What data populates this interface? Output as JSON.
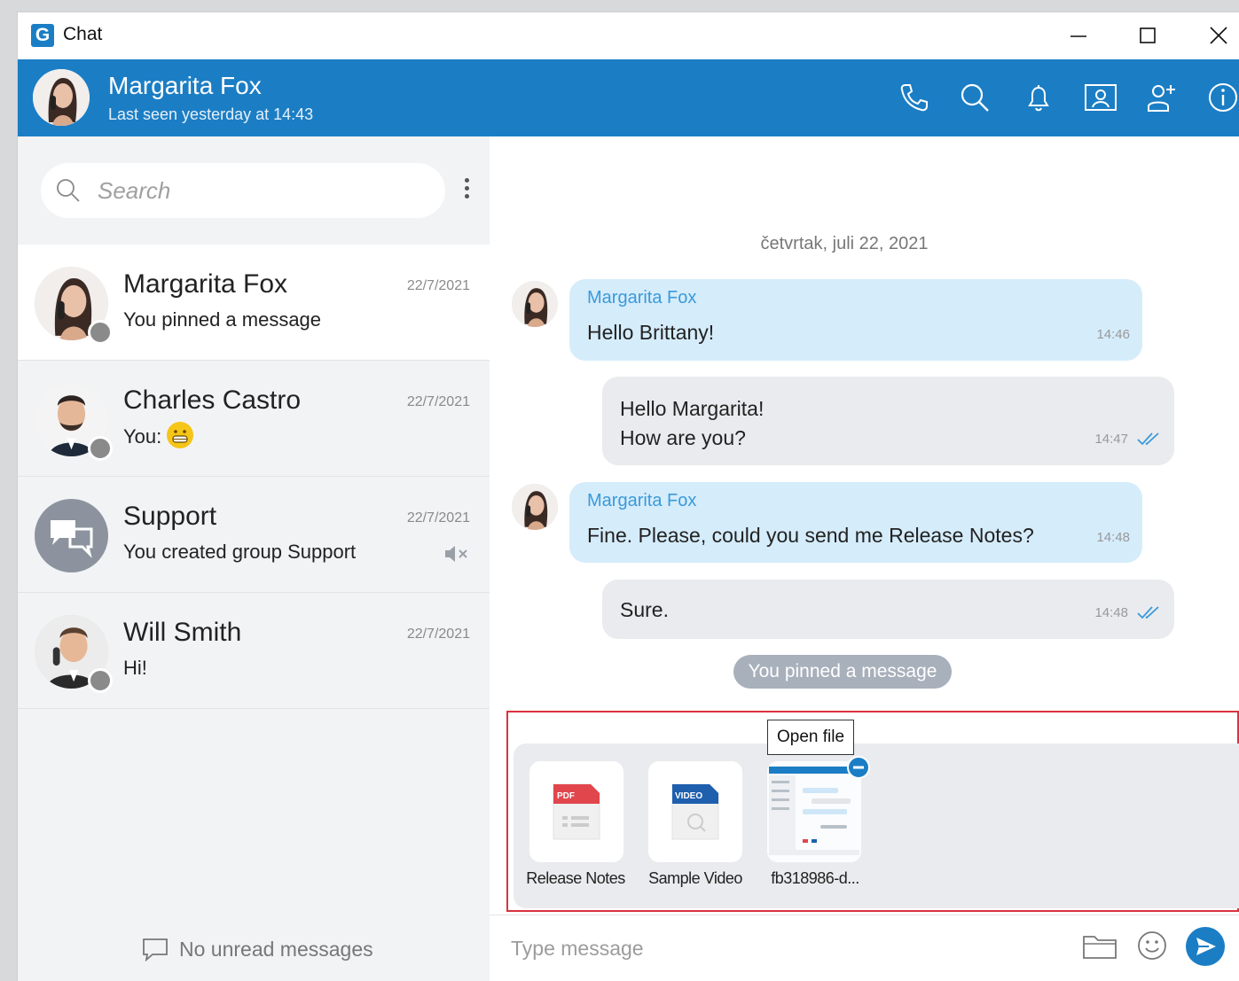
{
  "window": {
    "title": "Chat",
    "logo_letter": "G"
  },
  "header": {
    "contact_name": "Margarita Fox",
    "last_seen": "Last seen yesterday at 14:43"
  },
  "sidebar": {
    "search_placeholder": "Search",
    "conversations": [
      {
        "name": "Margarita Fox",
        "date": "22/7/2021",
        "preview": "You pinned a message"
      },
      {
        "name": "Charles Castro",
        "date": "22/7/2021",
        "preview": "You:"
      },
      {
        "name": "Support",
        "date": "22/7/2021",
        "preview": "You created group Support"
      },
      {
        "name": "Will Smith",
        "date": "22/7/2021",
        "preview": "Hi!"
      }
    ],
    "no_unread": "No unread messages"
  },
  "chat": {
    "date_separator": "četvrtak, juli 22, 2021",
    "messages": [
      {
        "sender": "Margarita Fox",
        "text": "Hello Brittany!",
        "time": "14:46"
      },
      {
        "text": "Hello Margarita!\nHow are you?",
        "time": "14:47"
      },
      {
        "sender": "Margarita Fox",
        "text": "Fine. Please, could you send me Release Notes?",
        "time": "14:48"
      },
      {
        "text": "Sure.",
        "time": "14:48"
      }
    ],
    "pinned_notice": "You pinned a message",
    "attachments": [
      {
        "label": "Release Notes",
        "badge": "PDF"
      },
      {
        "label": "Sample Video",
        "badge": "VIDEO"
      },
      {
        "label": "fb318986-d..."
      }
    ],
    "tooltip": "Open file",
    "composer_placeholder": "Type message"
  },
  "colors": {
    "accent": "#1b7ec5",
    "incoming_bubble": "#d5ecfb",
    "outgoing_bubble": "#eaebee",
    "highlight_border": "#d9333f"
  }
}
